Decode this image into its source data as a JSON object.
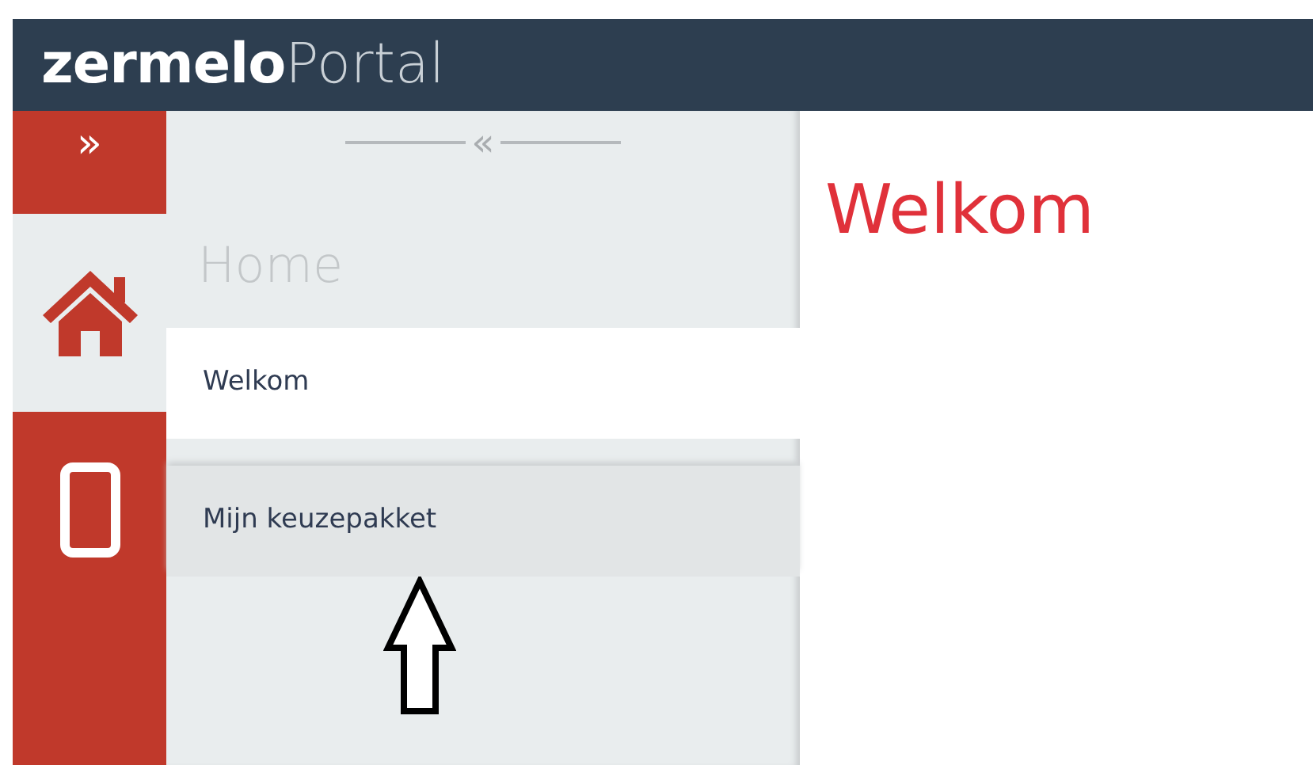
{
  "header": {
    "logo_bold": "zermelo",
    "logo_light": "Portal"
  },
  "rail": {
    "expand_label": "»",
    "apps": [
      {
        "kind": "home",
        "selected": true
      },
      {
        "kind": "phone",
        "selected": false
      }
    ]
  },
  "panel": {
    "collapse_label": "«",
    "title": "Home",
    "items": [
      {
        "label": "Welkom",
        "selected": true
      },
      {
        "label": "Mijn keuzepakket",
        "selected": false
      }
    ]
  },
  "main": {
    "heading": "Welkom"
  }
}
